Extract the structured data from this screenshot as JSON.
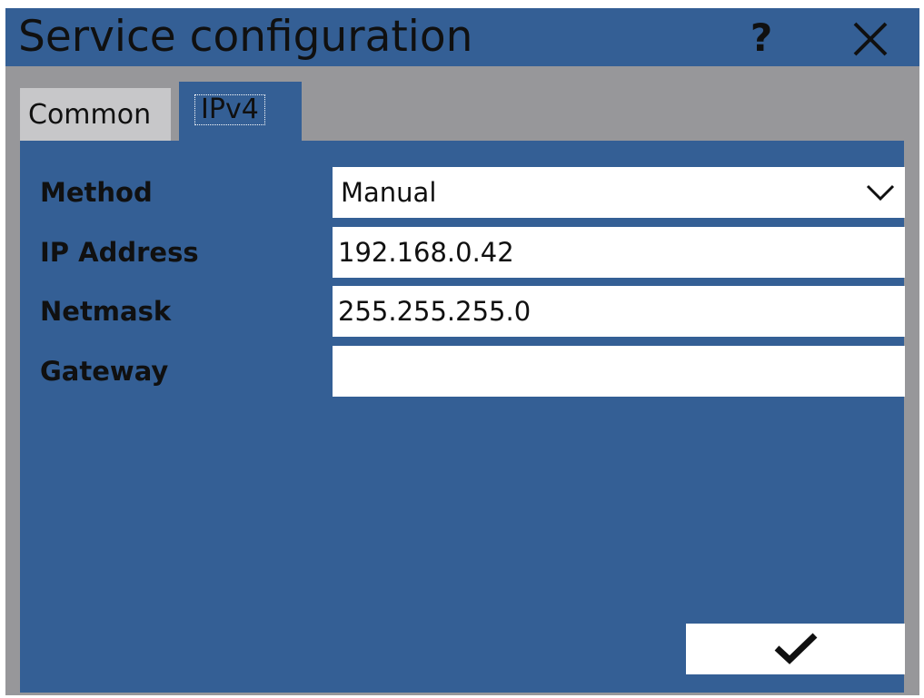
{
  "window": {
    "title": "Service configuration",
    "help_label": "?",
    "close_icon": "close-icon"
  },
  "tabs": [
    {
      "label": "Common",
      "selected": false
    },
    {
      "label": "IPv4",
      "selected": true
    }
  ],
  "ipv4": {
    "method": {
      "label": "Method",
      "value": "Manual"
    },
    "ip_address": {
      "label": "IP Address",
      "value": "192.168.0.42"
    },
    "netmask": {
      "label": "Netmask",
      "value": "255.255.255.0"
    },
    "gateway": {
      "label": "Gateway",
      "value": ""
    }
  },
  "actions": {
    "confirm_icon": "checkmark-icon"
  },
  "colors": {
    "accent": "#345f95",
    "background": "#97979a",
    "inactive_tab": "#c7c7c9",
    "field": "#ffffff",
    "text": "#101010"
  }
}
